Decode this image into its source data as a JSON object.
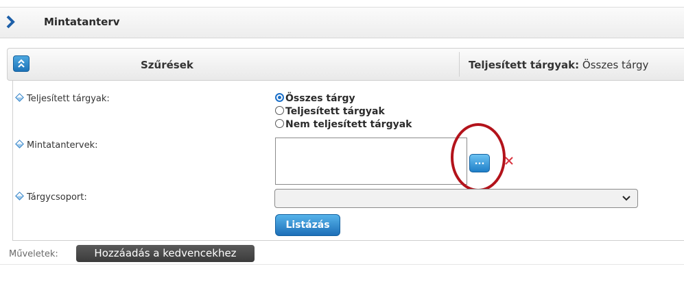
{
  "page": {
    "title": "Mintatanterv"
  },
  "filters": {
    "title": "Szűrések",
    "status_label": "Teljesített tárgyak:",
    "status_value": " Összes tárgy"
  },
  "fields": {
    "completed": {
      "label": "Teljesített tárgyak:",
      "options": [
        {
          "label": "Összes tárgy",
          "selected": true
        },
        {
          "label": "Teljesített tárgyak",
          "selected": false
        },
        {
          "label": "Nem teljesített tárgyak",
          "selected": false
        }
      ]
    },
    "curricula": {
      "label": "Mintatantervek:",
      "value": "",
      "browse_label": "..."
    },
    "subject_group": {
      "label": "Tárgycsoport:",
      "selected": ""
    }
  },
  "buttons": {
    "list_label": "Listázás"
  },
  "actions": {
    "label": "Műveletek:",
    "favorite_label": "Hozzáadás a kedvencekhez"
  },
  "colors": {
    "accent": "#1d73b8",
    "highlight": "#b3131b",
    "clear": "#d9333f"
  }
}
